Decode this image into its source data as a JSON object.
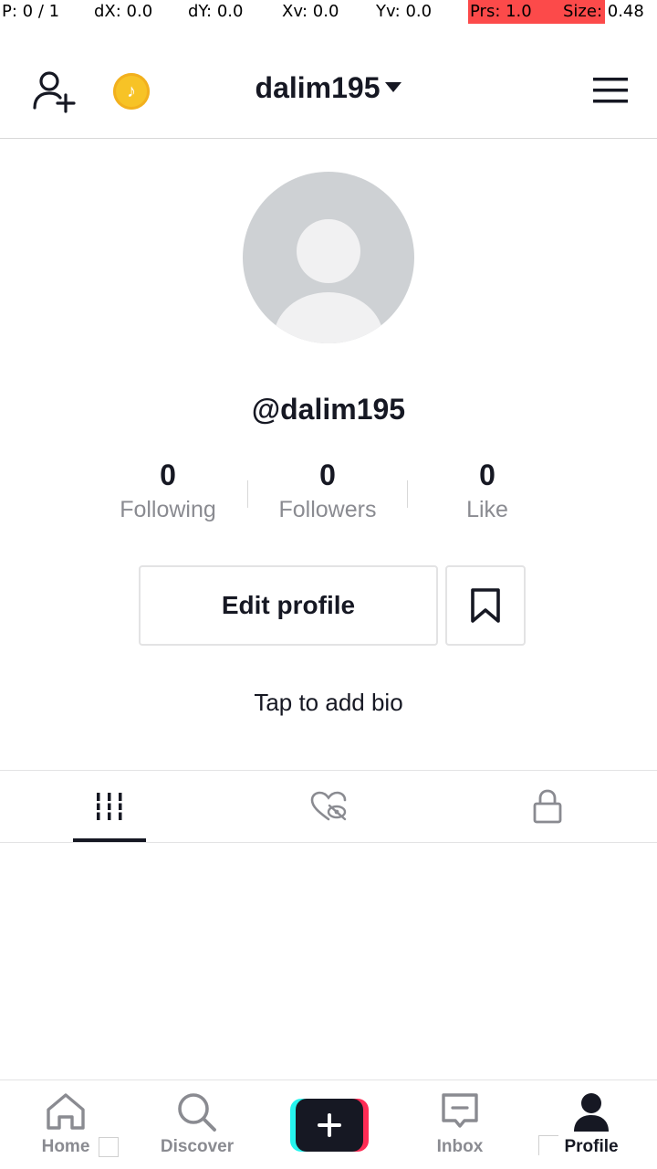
{
  "debug": {
    "pointer": "P: 0 / 1",
    "dx": "dX: 0.0",
    "dy": "dY: 0.0",
    "xv": "Xv: 0.0",
    "yv": "Yv: 0.0",
    "prs": "Prs: 1.0",
    "size": "Size: 0.48",
    "highlight_color": "#fc4a4a"
  },
  "header": {
    "username": "dalim195",
    "add_friend_icon": "add-friend-icon",
    "coin_icon": "coin-icon",
    "menu_icon": "hamburger-menu-icon"
  },
  "profile": {
    "handle": "@dalim195",
    "stats": [
      {
        "value": "0",
        "label": "Following"
      },
      {
        "value": "0",
        "label": "Followers"
      },
      {
        "value": "0",
        "label": "Like"
      }
    ],
    "edit_profile_label": "Edit profile",
    "bio_prompt": "Tap to add bio"
  },
  "tabs": [
    {
      "icon": "videos-grid-icon",
      "active": true
    },
    {
      "icon": "liked-hidden-icon",
      "active": false
    },
    {
      "icon": "private-lock-icon",
      "active": false
    }
  ],
  "bottom_nav": [
    {
      "label": "Home",
      "icon": "home-icon"
    },
    {
      "label": "Discover",
      "icon": "search-icon"
    },
    {
      "label": "",
      "icon": "create-plus-icon"
    },
    {
      "label": "Inbox",
      "icon": "inbox-icon"
    },
    {
      "label": "Profile",
      "icon": "profile-icon",
      "active": true
    }
  ],
  "colors": {
    "text_primary": "#161823",
    "text_secondary": "#8a8b91",
    "coin": "#f7c326",
    "brand_cyan": "#25f4ee",
    "brand_pink": "#fe2c55"
  }
}
